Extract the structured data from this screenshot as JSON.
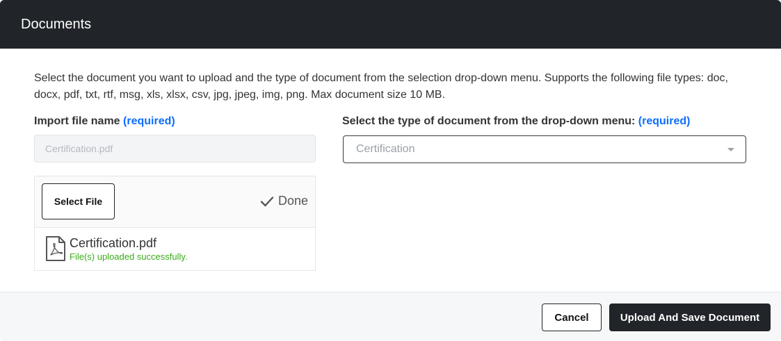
{
  "modal": {
    "title": "Documents"
  },
  "description": "Select the document you want to upload and the type of document from the selection drop-down menu. Supports the following file types: doc, docx, pdf, txt, rtf, msg, xls, xlsx, csv, jpg, jpeg, img, png. Max document size 10 MB.",
  "import_field": {
    "label": "Import file name",
    "required": "(required)",
    "placeholder": "Certification.pdf"
  },
  "type_field": {
    "label": "Select the type of document from the drop-down menu:",
    "required": "(required)",
    "selected": "Certification"
  },
  "uploader": {
    "select_button": "Select File",
    "status": "Done",
    "files": [
      {
        "name": "Certification.pdf",
        "status": "File(s) uploaded successfully.",
        "icon": "pdf-file-icon"
      }
    ]
  },
  "footer": {
    "cancel": "Cancel",
    "save": "Upload And Save Document"
  },
  "colors": {
    "header_bg": "#212529",
    "required_link": "#0d6efd",
    "success": "#3bab1a"
  }
}
